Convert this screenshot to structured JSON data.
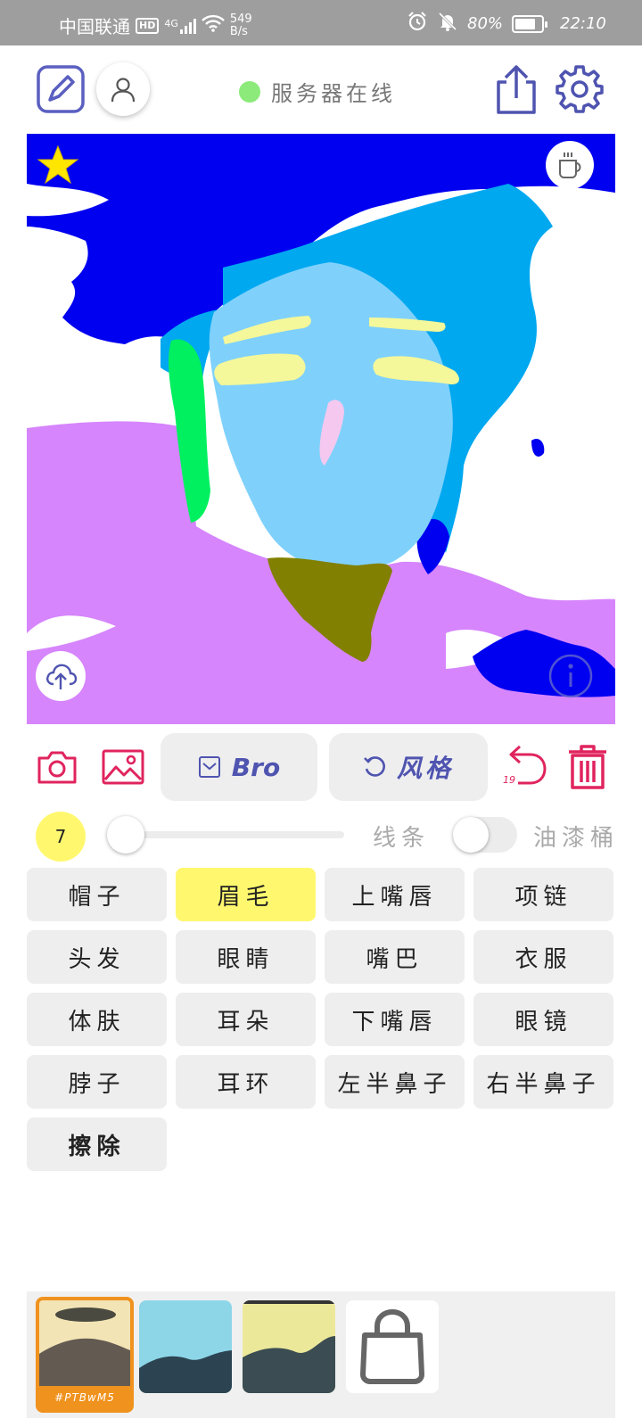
{
  "status_bar": {
    "carrier": "中国联通",
    "hd": "HD",
    "network": "4G",
    "speed_value": "549",
    "speed_unit": "B/s",
    "battery": "80%",
    "battery_level": 0.8,
    "time": "22:10"
  },
  "header": {
    "server_status": "服务器在线",
    "server_status_color": "#8cea7a",
    "accent": "#4f54b0"
  },
  "toolbar": {
    "bro_label": "Bro",
    "style_label": "风格",
    "undo_count": "19",
    "danger_color": "#e0245e"
  },
  "brush": {
    "size": "7",
    "line_label": "线条",
    "bucket_label": "油漆桶",
    "bucket_enabled": false
  },
  "parts": [
    {
      "label": "帽子",
      "active": false
    },
    {
      "label": "眉毛",
      "active": true
    },
    {
      "label": "上嘴唇",
      "active": false
    },
    {
      "label": "项链",
      "active": false
    },
    {
      "label": "头发",
      "active": false
    },
    {
      "label": "眼睛",
      "active": false
    },
    {
      "label": "嘴巴",
      "active": false
    },
    {
      "label": "衣服",
      "active": false
    },
    {
      "label": "体肤",
      "active": false
    },
    {
      "label": "耳朵",
      "active": false
    },
    {
      "label": "下嘴唇",
      "active": false
    },
    {
      "label": "眼镜",
      "active": false
    },
    {
      "label": "脖子",
      "active": false
    },
    {
      "label": "耳环",
      "active": false
    },
    {
      "label": "左半鼻子",
      "active": false
    },
    {
      "label": "右半鼻子",
      "active": false
    },
    {
      "label": "擦除",
      "active": false
    }
  ],
  "styles": [
    {
      "tag": "#PTBwM5",
      "selected": true
    },
    {
      "tag": "",
      "selected": false
    },
    {
      "tag": "",
      "selected": false
    }
  ],
  "colors": {
    "highlight": "#fff86f",
    "selected_style": "#f0921e",
    "canvas_blue": "#0000f0",
    "canvas_lightblue": "#00a8f0",
    "canvas_face": "#7fd1fb",
    "canvas_purple": "#d685fd",
    "canvas_green": "#00f060",
    "canvas_olive": "#828000",
    "canvas_yellow": "#f4f79a",
    "canvas_pink": "#f5c8f0"
  }
}
